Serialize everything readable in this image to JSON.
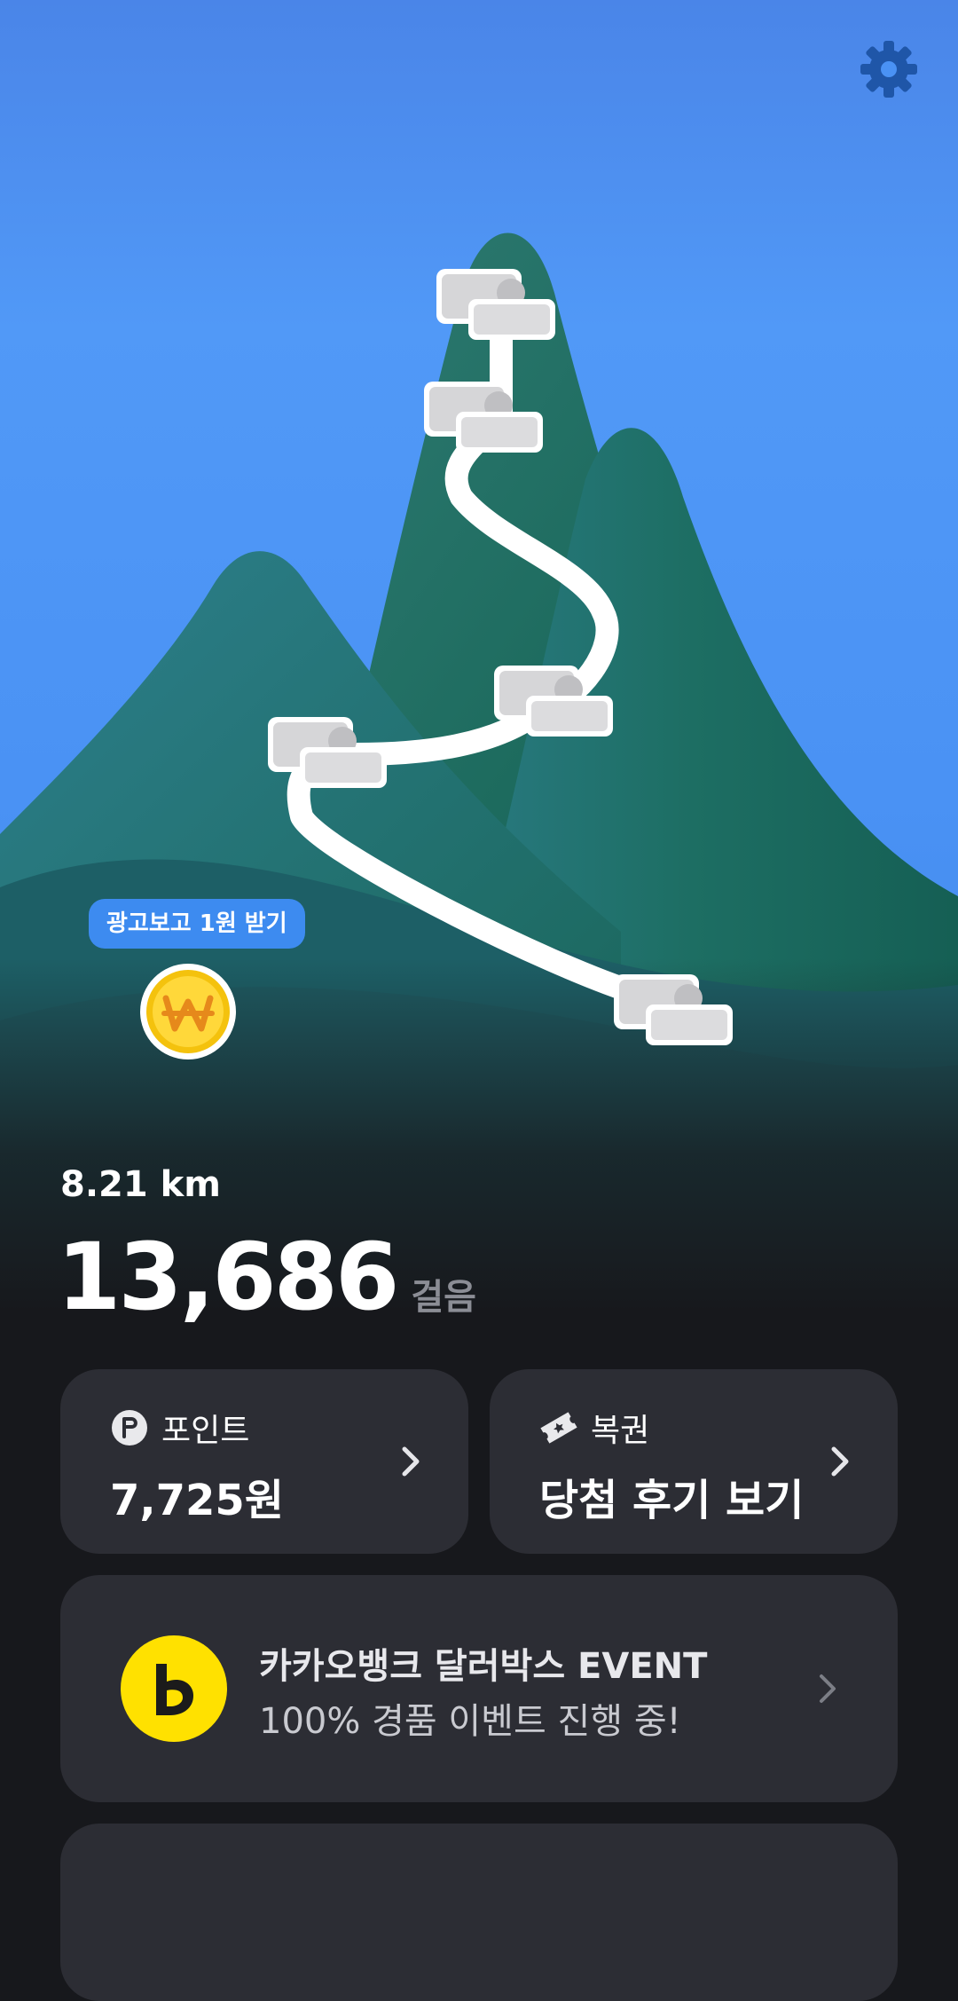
{
  "header": {
    "settings_icon": "gear-icon"
  },
  "map": {
    "ad_reward_label": "광고보고 1원 받기",
    "coin_icon": "won-coin-icon",
    "sky_color": "#4d93f7",
    "mountain_color": "#1f6d62"
  },
  "stats": {
    "distance": "8.21 km",
    "steps": "13,686",
    "steps_unit": "걸음"
  },
  "cards": {
    "points": {
      "icon": "point-p-icon",
      "label": "포인트",
      "value": "7,725원"
    },
    "lottery": {
      "icon": "ticket-icon",
      "label": "복권",
      "value": "당첨 후기 보기"
    }
  },
  "event": {
    "logo_icon": "kakaobank-logo-icon",
    "title": "카카오뱅크 달러박스 EVENT",
    "subtitle": "100% 경품 이벤트 진행 중!",
    "logo_color": "#ffe100"
  }
}
